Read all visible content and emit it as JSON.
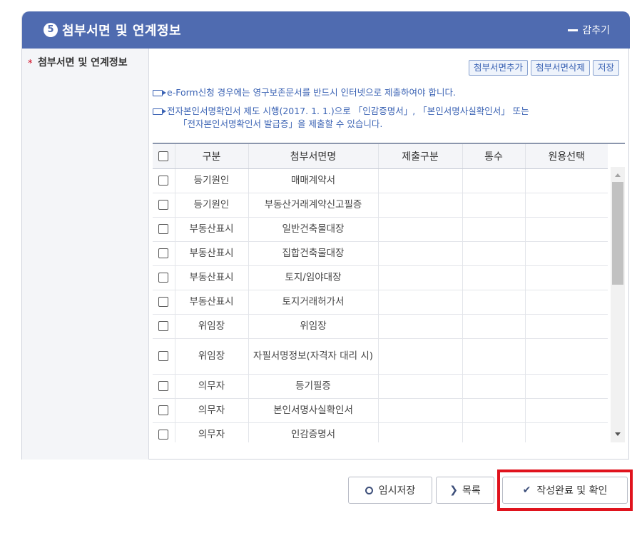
{
  "section": {
    "step_number": "5",
    "title": "첨부서면 및 연계정보",
    "collapse_label": "감추기"
  },
  "field": {
    "required_mark": "*",
    "label": "첨부서면 및 연계정보"
  },
  "toolbar": {
    "add_label": "첨부서면추가",
    "delete_label": "첨부서면삭제",
    "save_label": "저장"
  },
  "notices": [
    "e-Form신청 경우에는 영구보존문서를 반드시 인터넷으로 제출하여야 합니다.",
    "전자본인서명확인서 제도 시행(2017. 1. 1.)으로 「인감증명서」, 「본인서명사실확인서」 또는",
    "「전자본인서명확인서 발급증」을 제출할 수 있습니다."
  ],
  "table": {
    "columns": [
      "구분",
      "첨부서면명",
      "제출구분",
      "통수",
      "원용선택"
    ],
    "rows": [
      {
        "category": "등기원인",
        "document": "매매계약서"
      },
      {
        "category": "등기원인",
        "document": "부동산거래계약신고필증"
      },
      {
        "category": "부동산표시",
        "document": "일반건축물대장"
      },
      {
        "category": "부동산표시",
        "document": "집합건축물대장"
      },
      {
        "category": "부동산표시",
        "document": "토지/임야대장"
      },
      {
        "category": "부동산표시",
        "document": "토지거래허가서"
      },
      {
        "category": "위임장",
        "document": "위임장"
      },
      {
        "category": "위임장",
        "document": "자필서명정보(자격자 대리 시)"
      },
      {
        "category": "의무자",
        "document": "등기필증"
      },
      {
        "category": "의무자",
        "document": "본인서명사실확인서"
      },
      {
        "category": "의무자",
        "document": "인감증명서"
      }
    ]
  },
  "footer": {
    "temp_save_label": "임시저장",
    "list_label": "목록",
    "complete_label": "작성완료 및 확인"
  },
  "colors": {
    "header_bg": "#4f6bb0",
    "link_blue": "#3b63b4",
    "highlight_red": "#e0131d"
  }
}
